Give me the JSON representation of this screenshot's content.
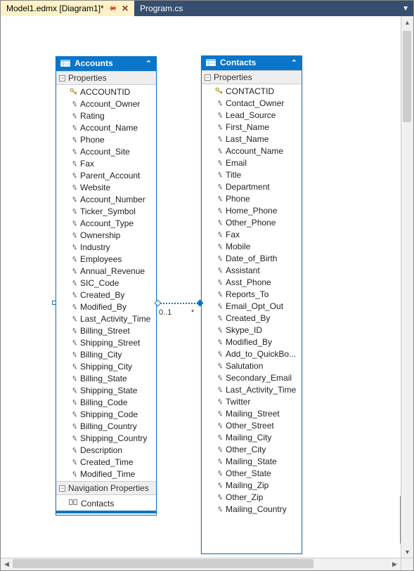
{
  "tabs": [
    {
      "label": "Model1.edmx [Diagram1]*",
      "active": true,
      "pinned": true
    },
    {
      "label": "Program.cs",
      "active": false,
      "pinned": false
    }
  ],
  "relationship": {
    "left_cardinality": "0..1",
    "right_cardinality": "*"
  },
  "sections": {
    "properties_label": "Properties",
    "nav_properties_label": "Navigation Properties",
    "toggle_glyph": "−",
    "header_collapse_glyph": "⌃"
  },
  "entities": {
    "accounts": {
      "title": "Accounts",
      "key_props": [
        "ACCOUNTID"
      ],
      "props": [
        "Account_Owner",
        "Rating",
        "Account_Name",
        "Phone",
        "Account_Site",
        "Fax",
        "Parent_Account",
        "Website",
        "Account_Number",
        "Ticker_Symbol",
        "Account_Type",
        "Ownership",
        "Industry",
        "Employees",
        "Annual_Revenue",
        "SIC_Code",
        "Created_By",
        "Modified_By",
        "Last_Activity_Time",
        "Billing_Street",
        "Shipping_Street",
        "Billing_City",
        "Shipping_City",
        "Billing_State",
        "Shipping_State",
        "Billing_Code",
        "Shipping_Code",
        "Billing_Country",
        "Shipping_Country",
        "Description",
        "Created_Time",
        "Modified_Time"
      ],
      "nav_props": [
        "Contacts"
      ]
    },
    "contacts": {
      "title": "Contacts",
      "key_props": [
        "CONTACTID"
      ],
      "props": [
        "Contact_Owner",
        "Lead_Source",
        "First_Name",
        "Last_Name",
        "Account_Name",
        "Email",
        "Title",
        "Department",
        "Phone",
        "Home_Phone",
        "Other_Phone",
        "Fax",
        "Mobile",
        "Date_of_Birth",
        "Assistant",
        "Asst_Phone",
        "Reports_To",
        "Email_Opt_Out",
        "Created_By",
        "Skype_ID",
        "Modified_By",
        "Add_to_QuickBo...",
        "Salutation",
        "Secondary_Email",
        "Last_Activity_Time",
        "Twitter",
        "Mailing_Street",
        "Other_Street",
        "Mailing_City",
        "Other_City",
        "Mailing_State",
        "Other_State",
        "Mailing_Zip",
        "Other_Zip",
        "Mailing_Country"
      ]
    }
  }
}
